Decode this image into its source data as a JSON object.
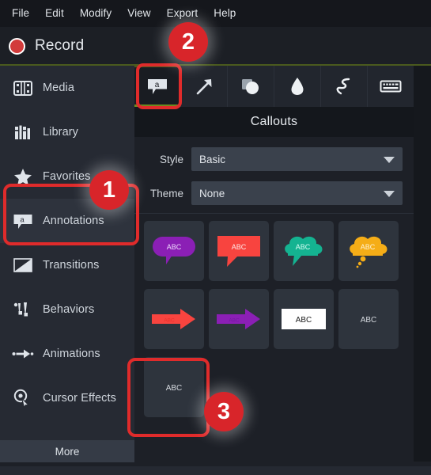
{
  "menubar": {
    "items": [
      {
        "label": "File"
      },
      {
        "label": "Edit"
      },
      {
        "label": "Modify"
      },
      {
        "label": "View"
      },
      {
        "label": "Export"
      },
      {
        "label": "Help"
      }
    ]
  },
  "recordbar": {
    "label": "Record",
    "icon": "record-dot-icon",
    "accent": "#d23b3b"
  },
  "sidebar": {
    "items": [
      {
        "label": "Media",
        "icon": "film-strip-icon",
        "active": false
      },
      {
        "label": "Library",
        "icon": "books-icon",
        "active": false
      },
      {
        "label": "Favorites",
        "icon": "star-icon",
        "active": false
      },
      {
        "label": "Annotations",
        "icon": "callout-a-icon",
        "active": true
      },
      {
        "label": "Transitions",
        "icon": "transition-icon",
        "active": false
      },
      {
        "label": "Behaviors",
        "icon": "behaviors-icon",
        "active": false
      },
      {
        "label": "Animations",
        "icon": "animation-arrow-icon",
        "active": false
      },
      {
        "label": "Cursor Effects",
        "icon": "cursor-effects-icon",
        "active": false
      }
    ],
    "more_label": "More"
  },
  "panel": {
    "tabs": [
      {
        "name": "callouts",
        "icon": "callout-a-icon",
        "active": true
      },
      {
        "name": "arrows",
        "icon": "arrow-diagonal-icon",
        "active": false
      },
      {
        "name": "shapes",
        "icon": "shape-circle-icon",
        "active": false
      },
      {
        "name": "blur",
        "icon": "droplet-icon",
        "active": false
      },
      {
        "name": "sketch",
        "icon": "squiggle-icon",
        "active": false
      },
      {
        "name": "keystrokes",
        "icon": "keyboard-icon",
        "active": false
      }
    ],
    "title": "Callouts",
    "fields": [
      {
        "label": "Style",
        "value": "Basic"
      },
      {
        "label": "Theme",
        "value": "None"
      }
    ]
  },
  "thumbnails": [
    {
      "id": "purple-bubble",
      "text": "ABC",
      "shape": "rounded-bubble",
      "color": "#8b1fb5",
      "text_color": "#f0dcff"
    },
    {
      "id": "red-rect",
      "text": "ABC",
      "shape": "rect-bubble",
      "color": "#f8443f",
      "text_color": "#ffe9e8"
    },
    {
      "id": "teal-cloud",
      "text": "ABC",
      "shape": "cloud-bubble",
      "color": "#14b391",
      "text_color": "#d9fff5"
    },
    {
      "id": "yellow-thought",
      "text": "ABC",
      "shape": "thought-cloud",
      "color": "#f5ad17",
      "text_color": "#fff3d6"
    },
    {
      "id": "red-arrow",
      "text": "ABC",
      "shape": "arrow",
      "color": "#f8443f",
      "text_color": "#ffd9d7"
    },
    {
      "id": "purple-arrow",
      "text": "ABC",
      "shape": "arrow",
      "color": "#8b1fb5",
      "text_color": "#e8ccff"
    },
    {
      "id": "white-box",
      "text": "ABC",
      "shape": "filled-box",
      "color": "#ffffff",
      "text_color": "#1a1a1a"
    },
    {
      "id": "plain-text",
      "text": "ABC",
      "shape": "text-only",
      "color": "transparent",
      "text_color": "#d6dae0"
    },
    {
      "id": "plain-text-2",
      "text": "ABC",
      "shape": "text-only",
      "color": "transparent",
      "text_color": "#d6dae0"
    }
  ],
  "annotations": {
    "badges": [
      {
        "number": "1",
        "target": "sidebar-item-annotations"
      },
      {
        "number": "2",
        "target": "tab-callouts"
      },
      {
        "number": "3",
        "target": "thumbnail-plain-text-2"
      }
    ],
    "highlight_color": "#e02b2b"
  }
}
